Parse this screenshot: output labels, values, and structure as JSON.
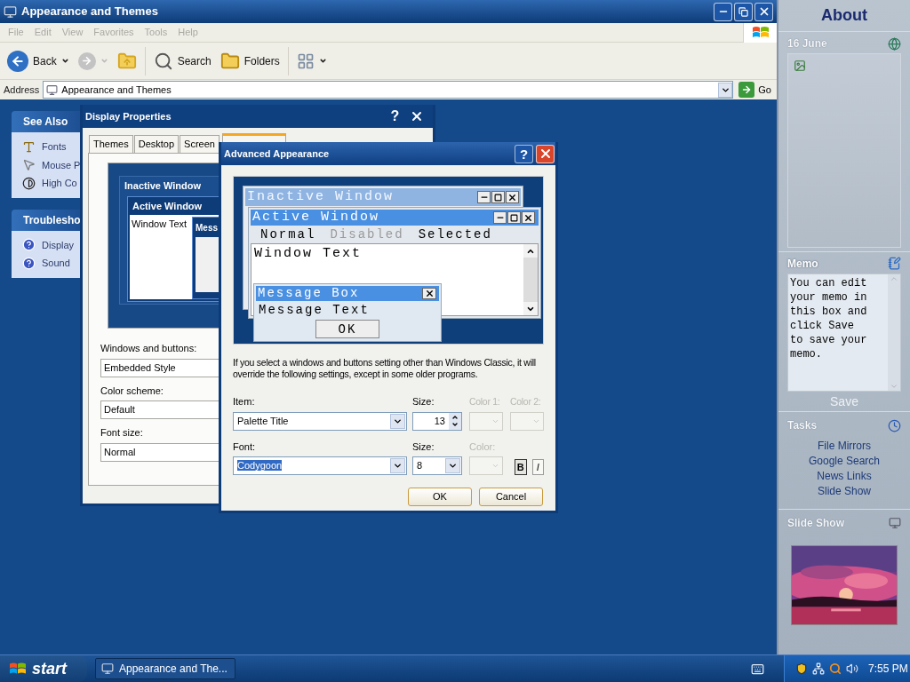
{
  "explorer": {
    "title": "Appearance and Themes",
    "menu": [
      {
        "label": "File",
        "disabled": true
      },
      {
        "label": "Edit",
        "disabled": true
      },
      {
        "label": "View",
        "disabled": true
      },
      {
        "label": "Favorites",
        "disabled": true
      },
      {
        "label": "Tools",
        "disabled": true
      },
      {
        "label": "Help",
        "disabled": true
      }
    ],
    "toolbar": [
      {
        "kind": "back",
        "label": "Back"
      },
      {
        "kind": "forward"
      },
      {
        "kind": "up"
      },
      {
        "kind": "search",
        "label": "Search"
      },
      {
        "kind": "folders",
        "label": "Folders"
      },
      {
        "kind": "views"
      }
    ],
    "address": {
      "label": "Address",
      "value": "Appearance and Themes",
      "go": "Go"
    }
  },
  "task_panes": [
    {
      "title": "See Also",
      "items": [
        {
          "kind": "fonts",
          "label": "Fonts"
        },
        {
          "kind": "mouse",
          "label": "Mouse P"
        },
        {
          "kind": "contrast",
          "label": "High Co"
        }
      ]
    },
    {
      "title": "Troublesho",
      "items": [
        {
          "kind": "help",
          "label": "Display"
        },
        {
          "kind": "help",
          "label": "Sound"
        }
      ]
    }
  ],
  "display_properties": {
    "title": "Display Properties",
    "help": "?",
    "tabs": [
      {
        "label": "Themes",
        "selected": false
      },
      {
        "label": "Desktop",
        "selected": false
      },
      {
        "label": "Screen",
        "selected": false
      },
      {
        "selected": true
      }
    ],
    "preview": {
      "inactive_title": "Inactive Window",
      "active_title": "Active Window",
      "window_text": "Window Text",
      "message_title": "Mess"
    },
    "fields": [
      {
        "label": "Windows and buttons:",
        "value": "Embedded Style"
      },
      {
        "label": "Color scheme:",
        "value": "Default"
      },
      {
        "label": "Font size:",
        "value": "Normal"
      }
    ]
  },
  "advanced_appearance": {
    "title": "Advanced Appearance",
    "help": "?",
    "preview": {
      "inactive_title": "Inactive Window",
      "active_title": "Active Window",
      "menu": [
        {
          "label": "Normal",
          "disabled": false
        },
        {
          "label": "Disabled",
          "disabled": true
        },
        {
          "label": "Selected",
          "disabled": false
        }
      ],
      "window_text": "Window Text",
      "message_title": "Message Box",
      "message_text": "Message Text",
      "ok": "OK"
    },
    "note": "If you select a windows and buttons setting other than Windows Classic, it will override the following settings, except in some older programs.",
    "item": {
      "label": "Item:",
      "value": "Palette Title"
    },
    "item_size": {
      "label": "Size:",
      "value": "13"
    },
    "color1": {
      "label": "Color 1:",
      "disabled": true
    },
    "color2": {
      "label": "Color 2:",
      "disabled": true
    },
    "font": {
      "label": "Font:",
      "value": "Codygoon"
    },
    "font_size": {
      "label": "Size:",
      "value": "8"
    },
    "font_color": {
      "label": "Color:",
      "disabled": true
    },
    "bold": {
      "label": "B",
      "pressed": true
    },
    "italic": {
      "label": "I",
      "pressed": false
    },
    "buttons": [
      "OK",
      "Cancel"
    ]
  },
  "sidebar": {
    "title": "About",
    "date": "16 June",
    "memo": {
      "title": "Memo",
      "text": "You can edit your memo in this box and click Save to save your memo.",
      "save": "Save"
    },
    "tasks": {
      "title": "Tasks",
      "links": [
        "File Mirrors",
        "Google Search",
        "News Links",
        "Slide Show"
      ]
    },
    "slideshow": {
      "title": "Slide Show"
    }
  },
  "taskbar": {
    "start": "start",
    "tasks": [
      {
        "label": "Appearance and The...",
        "selected": false
      }
    ],
    "clock": "7:55 PM"
  }
}
